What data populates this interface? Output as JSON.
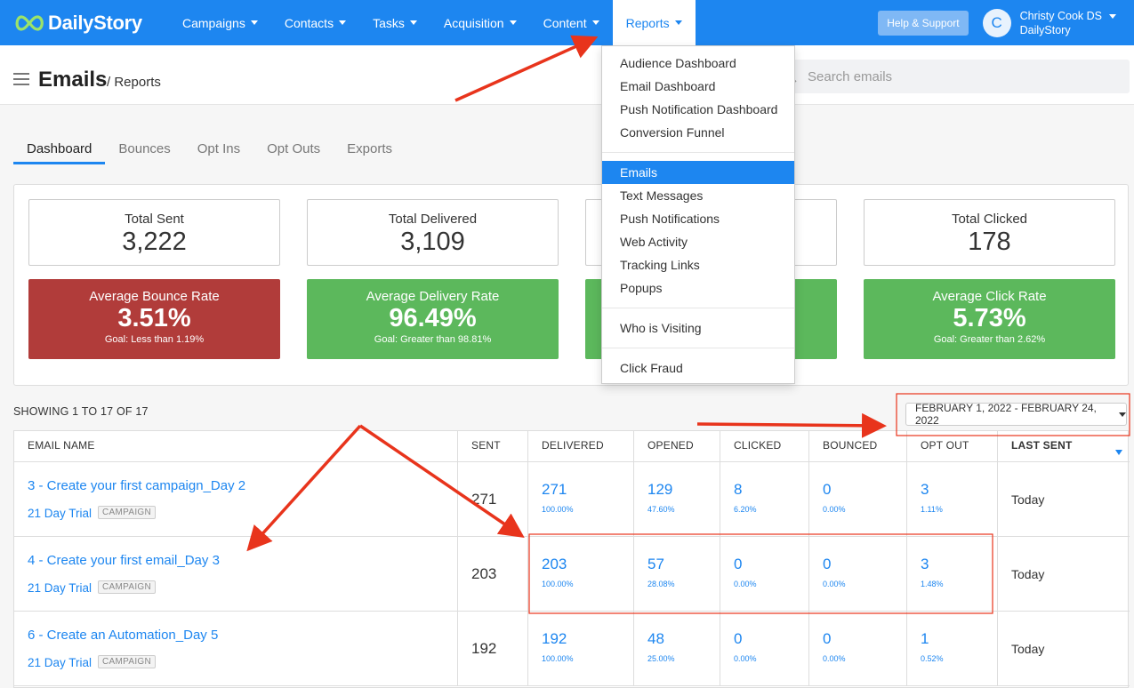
{
  "brand": {
    "name": "DailyStory"
  },
  "nav": {
    "items": [
      {
        "label": "Campaigns"
      },
      {
        "label": "Contacts"
      },
      {
        "label": "Tasks"
      },
      {
        "label": "Acquisition"
      },
      {
        "label": "Content"
      },
      {
        "label": "Reports"
      }
    ],
    "help_label": "Help & Support",
    "user": {
      "initial": "C",
      "name": "Christy Cook DS",
      "org": "DailyStory"
    }
  },
  "header": {
    "title": "Emails",
    "subtitle": "/ Reports",
    "search_placeholder": "Search emails"
  },
  "tabs": [
    {
      "label": "Dashboard"
    },
    {
      "label": "Bounces"
    },
    {
      "label": "Opt Ins"
    },
    {
      "label": "Opt Outs"
    },
    {
      "label": "Exports"
    }
  ],
  "stats": [
    {
      "label": "Total Sent",
      "value": "3,222"
    },
    {
      "label": "Total Delivered",
      "value": "3,109"
    },
    {
      "label": "Total Clicked",
      "value": "178"
    }
  ],
  "rates": [
    {
      "label": "Average Bounce Rate",
      "value": "3.51%",
      "goal": "Goal: Less than 1.19%",
      "color": "#b13c3a"
    },
    {
      "label": "Average Delivery Rate",
      "value": "96.49%",
      "goal": "Goal: Greater than 98.81%",
      "color": "#5cb85c"
    },
    {
      "label": "Average Click Rate",
      "value": "5.73%",
      "goal": "Goal: Greater than 2.62%",
      "color": "#5cb85c"
    }
  ],
  "reports_menu": {
    "group1": [
      "Audience Dashboard",
      "Email Dashboard",
      "Push Notification Dashboard",
      "Conversion Funnel"
    ],
    "group2": [
      "Emails",
      "Text Messages",
      "Push Notifications",
      "Web Activity",
      "Tracking Links",
      "Popups"
    ],
    "group3": [
      "Who is Visiting"
    ],
    "group4": [
      "Click Fraud"
    ],
    "selected": "Emails"
  },
  "table": {
    "showing": "SHOWING 1 TO 17 OF 17",
    "date_range": "FEBRUARY 1, 2022 - FEBRUARY 24, 2022",
    "headers": [
      "EMAIL NAME",
      "SENT",
      "DELIVERED",
      "OPENED",
      "CLICKED",
      "BOUNCED",
      "OPT OUT",
      "LAST SENT"
    ],
    "badge": "CAMPAIGN",
    "rows": [
      {
        "name": "3 - Create your first campaign_Day 2",
        "campaign": "21 Day Trial",
        "sent": "271",
        "delivered": "271",
        "delivered_pct": "100.00%",
        "opened": "129",
        "opened_pct": "47.60%",
        "clicked": "8",
        "clicked_pct": "6.20%",
        "bounced": "0",
        "bounced_pct": "0.00%",
        "optout": "3",
        "optout_pct": "1.11%",
        "last": "Today"
      },
      {
        "name": "4 - Create your first email_Day 3",
        "campaign": "21 Day Trial",
        "sent": "203",
        "delivered": "203",
        "delivered_pct": "100.00%",
        "opened": "57",
        "opened_pct": "28.08%",
        "clicked": "0",
        "clicked_pct": "0.00%",
        "bounced": "0",
        "bounced_pct": "0.00%",
        "optout": "3",
        "optout_pct": "1.48%",
        "last": "Today"
      },
      {
        "name": "6 - Create an Automation_Day 5",
        "campaign": "21 Day Trial",
        "sent": "192",
        "delivered": "192",
        "delivered_pct": "100.00%",
        "opened": "48",
        "opened_pct": "25.00%",
        "clicked": "0",
        "clicked_pct": "0.00%",
        "bounced": "0",
        "bounced_pct": "0.00%",
        "optout": "1",
        "optout_pct": "0.52%",
        "last": "Today"
      }
    ]
  },
  "colors": {
    "primary": "#1d86f0",
    "danger": "#b13c3a",
    "success": "#5cb85c",
    "annotation": "#e8341c"
  }
}
